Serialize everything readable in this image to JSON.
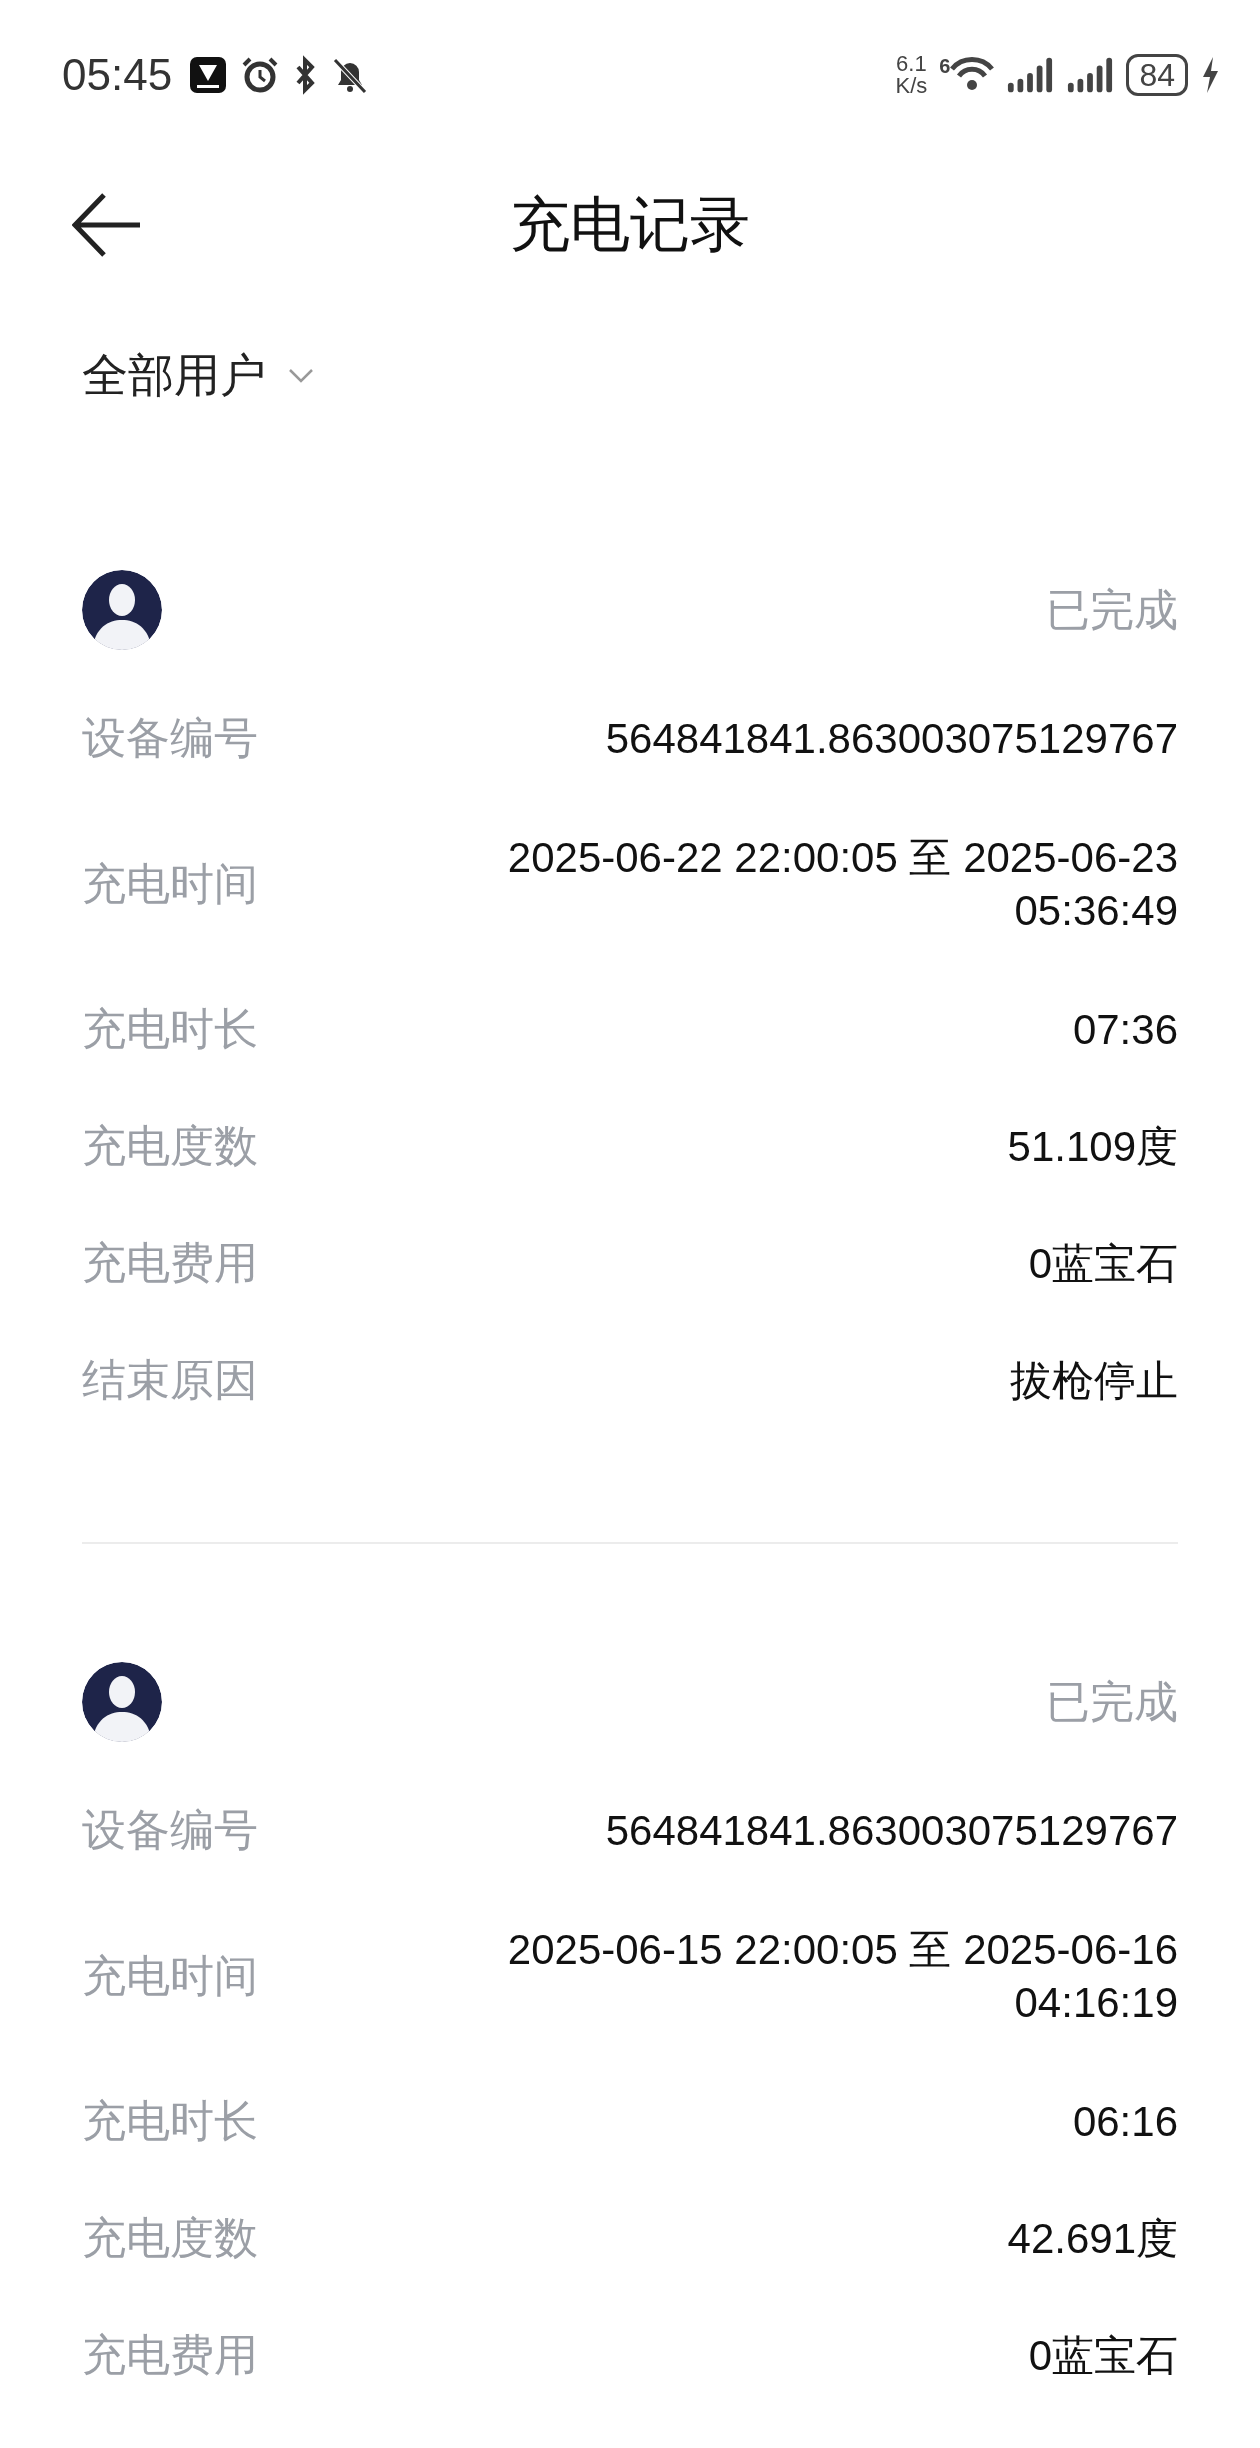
{
  "status_bar": {
    "time": "05:45",
    "speed_value": "6.1",
    "speed_unit": "K/s",
    "wifi_label": "6",
    "battery": "84"
  },
  "header": {
    "title": "充电记录"
  },
  "filter": {
    "label": "全部用户"
  },
  "records": [
    {
      "status": "已完成",
      "fields": [
        {
          "label": "设备编号",
          "value": "564841841.863003075129767"
        },
        {
          "label": "充电时间",
          "value": "2025-06-22 22:00:05 至 2025-06-23 05:36:49"
        },
        {
          "label": "充电时长",
          "value": "07:36"
        },
        {
          "label": "充电度数",
          "value": "51.109度"
        },
        {
          "label": "充电费用",
          "value": "0蓝宝石"
        },
        {
          "label": "结束原因",
          "value": "拔枪停止"
        }
      ]
    },
    {
      "status": "已完成",
      "fields": [
        {
          "label": "设备编号",
          "value": "564841841.863003075129767"
        },
        {
          "label": "充电时间",
          "value": "2025-06-15 22:00:05 至 2025-06-16 04:16:19"
        },
        {
          "label": "充电时长",
          "value": "06:16"
        },
        {
          "label": "充电度数",
          "value": "42.691度"
        },
        {
          "label": "充电费用",
          "value": "0蓝宝石"
        }
      ]
    }
  ]
}
